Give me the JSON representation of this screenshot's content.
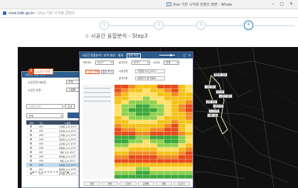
{
  "window": {
    "title": "Viso 기반 시각화 컨텐츠 화면 - Whale",
    "url": "visol.kdb.go.kr",
    "url_rest": "/ Viso 기반 시각화 콘텐츠"
  },
  "steps": {
    "numbers": [
      "1",
      "2",
      "3",
      "4"
    ],
    "active_index": 3,
    "title": "시공간 융합분석 - Step3"
  },
  "left_panel": {
    "badge": "3",
    "badge_label": "시공간 선택",
    "header": "시공간 대상 선택",
    "fields": [
      {
        "label": "시공간명 대분류 :",
        "value": "전체"
      },
      {
        "label": "시공간 분류 :",
        "value": "시설물"
      }
    ],
    "search_placeholder": "시설명 검색",
    "search_button": "검색",
    "filter_value": "전체",
    "group_button": "시공간 분석 대상 선택",
    "table_headers": [
      "선택",
      "코드",
      "시설명",
      "구분",
      "연도"
    ],
    "rows": [
      [
        "",
        "001",
        "가양동 도서_2017",
        "행정",
        "2017"
      ],
      [
        "",
        "002",
        "강남동 도서_2017",
        "행정",
        "2017"
      ],
      [
        "",
        "003",
        "고척동 도서_2017",
        "행정",
        "2017"
      ],
      [
        "",
        "004",
        "개포동 도서_2017",
        "행정",
        "2017"
      ],
      [
        "",
        "005",
        "교남동 도서_2017",
        "행정",
        "2017"
      ],
      [
        "",
        "006",
        "면목동 도서_2017",
        "행정",
        "2017"
      ],
      [
        "",
        "007",
        "목동 도서_2017",
        "행정",
        "2017"
      ],
      [
        "",
        "008",
        "방배동 도서_2017",
        "행정",
        "2017"
      ],
      [
        "",
        "009",
        "번동 도서_2017",
        "행정",
        "2017"
      ],
      [
        "",
        "010",
        "보문동 도서_2017",
        "행정",
        "2017"
      ],
      [
        "",
        "011",
        "불광동 도서_2017",
        "행정",
        "2017"
      ],
      [
        "",
        "012",
        "상계동 도서_2017",
        "행정",
        "2017"
      ]
    ],
    "selected_row": 9,
    "pager": "◀ 1 2 3 4 5 6 7 8 9 10 ▶",
    "bottom_button": "확인"
  },
  "dialog": {
    "title": "시공간 융합분석 : 분석 대상 - 결과",
    "head_button": "결과 저장",
    "form": {
      "label1": "기준년도",
      "value1": "2017",
      "label2": "분석기간",
      "value2": "2017",
      "label3": "시간대",
      "value3": "전체",
      "label4": "시공간명",
      "value4": "가양동 도서_2017",
      "label5": "분석기준",
      "value5": "유동인구 분석결과",
      "btn1": "시공간 선택",
      "btn2": "결과 보기"
    },
    "bottom_tabs": [
      "결과",
      "범례",
      "시간대",
      "요일별",
      "월별",
      "표 보기"
    ]
  },
  "map_labels": [
    "행정동 경계",
    "시설 밀집",
    "도서관",
    "시공간 결과",
    "공원 밀집",
    "상업지역",
    "주거지역",
    "교통시설"
  ],
  "colors": {
    "accent": "#2b5a8c",
    "highlight": "#e8541c",
    "heat_hot": "#e74c1c",
    "heat_mid": "#f4c21a",
    "heat_cool": "#3ca83c"
  }
}
